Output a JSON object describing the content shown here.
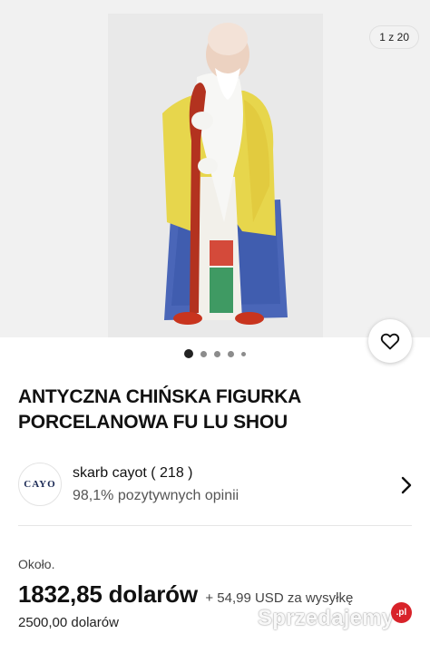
{
  "gallery": {
    "counter": "1 z 20",
    "dots_count": 5,
    "active_dot": 0
  },
  "listing": {
    "title": "ANTYCZNA CHIŃSKA FIGURKA PORCELANOWA FU LU SHOU"
  },
  "seller": {
    "logo_text": "CAYO",
    "name": "skarb cayot ( 218 )",
    "rating": "98,1% pozytywnych opinii"
  },
  "price": {
    "approx_label": "Około.",
    "amount": "1832,85 dolarów",
    "shipping": "+ 54,99 USD za wysyłkę",
    "original": "2500,00 dolarów"
  },
  "watermark": {
    "text": "Sprzedajemy",
    "badge": ".pl"
  },
  "icons": {
    "favorite": "heart-icon",
    "seller_details": "chevron-right-icon"
  },
  "colors": {
    "photo_bg": "#e9e9e9",
    "robe_yellow": "#e8d64a",
    "robe_blue": "#3d5fb3",
    "staff_red": "#b3321f",
    "watermark_badge": "#d8232a"
  }
}
